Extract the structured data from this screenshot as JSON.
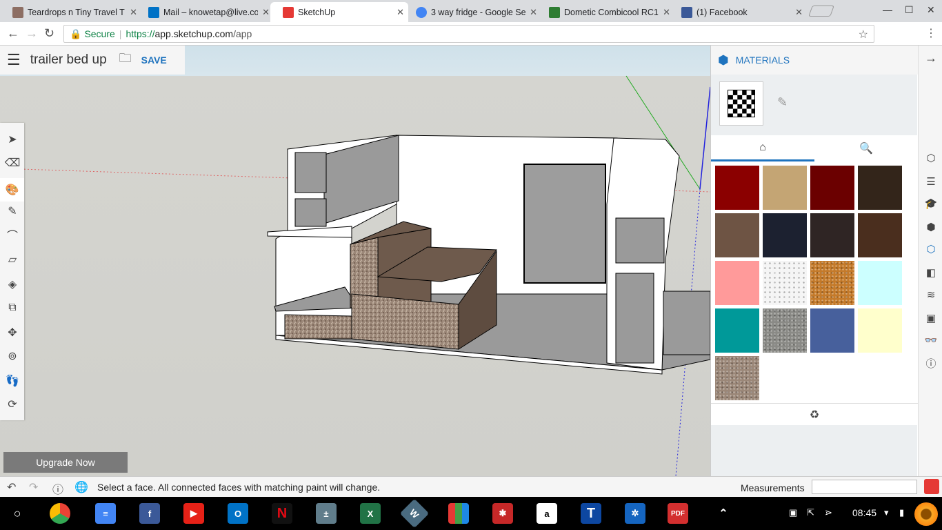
{
  "browser": {
    "tabs": [
      {
        "title": "Teardrops n Tiny Travel T",
        "icon": "trailer-favicon",
        "color": "#8d6e63"
      },
      {
        "title": "Mail – knowetap@live.co",
        "icon": "outlook-favicon",
        "color": "#0072c6"
      },
      {
        "title": "SketchUp",
        "icon": "sketchup-favicon",
        "color": "#e53935"
      },
      {
        "title": "3 way fridge - Google Sea",
        "icon": "google-favicon",
        "color": "#4285f4"
      },
      {
        "title": "Dometic Combicool RC1",
        "icon": "rv-favicon",
        "color": "#2e7d32"
      },
      {
        "title": "(1) Facebook",
        "icon": "facebook-favicon",
        "color": "#3b5998"
      }
    ],
    "close_glyph": "✕",
    "secure_label": "Secure",
    "url_scheme": "https://",
    "url_host": "app.sketchup.com",
    "url_path": "/app"
  },
  "app": {
    "document_title": "trailer bed up",
    "save_label": "SAVE",
    "upgrade_label": "Upgrade Now",
    "status_message": "Select a face. All connected faces with matching paint will change.",
    "measurements_label": "Measurements",
    "accent": "#1e73be"
  },
  "materials": {
    "title": "MATERIALS",
    "swatches": [
      "#8b0000",
      "#c4a574",
      "#6b0000",
      "#33251a",
      "#6e5444",
      "#1c2130",
      "#2f2524",
      "#4a2e1e",
      "#ff9a9a",
      "#f4f4f4",
      "#c47a2a",
      "#ccffff",
      "#009999",
      "#8a8a86",
      "#47609c",
      "#ffffcc",
      "#9b8778"
    ],
    "textured": [
      9,
      10,
      13,
      16
    ]
  },
  "system": {
    "clock": "08:45"
  }
}
